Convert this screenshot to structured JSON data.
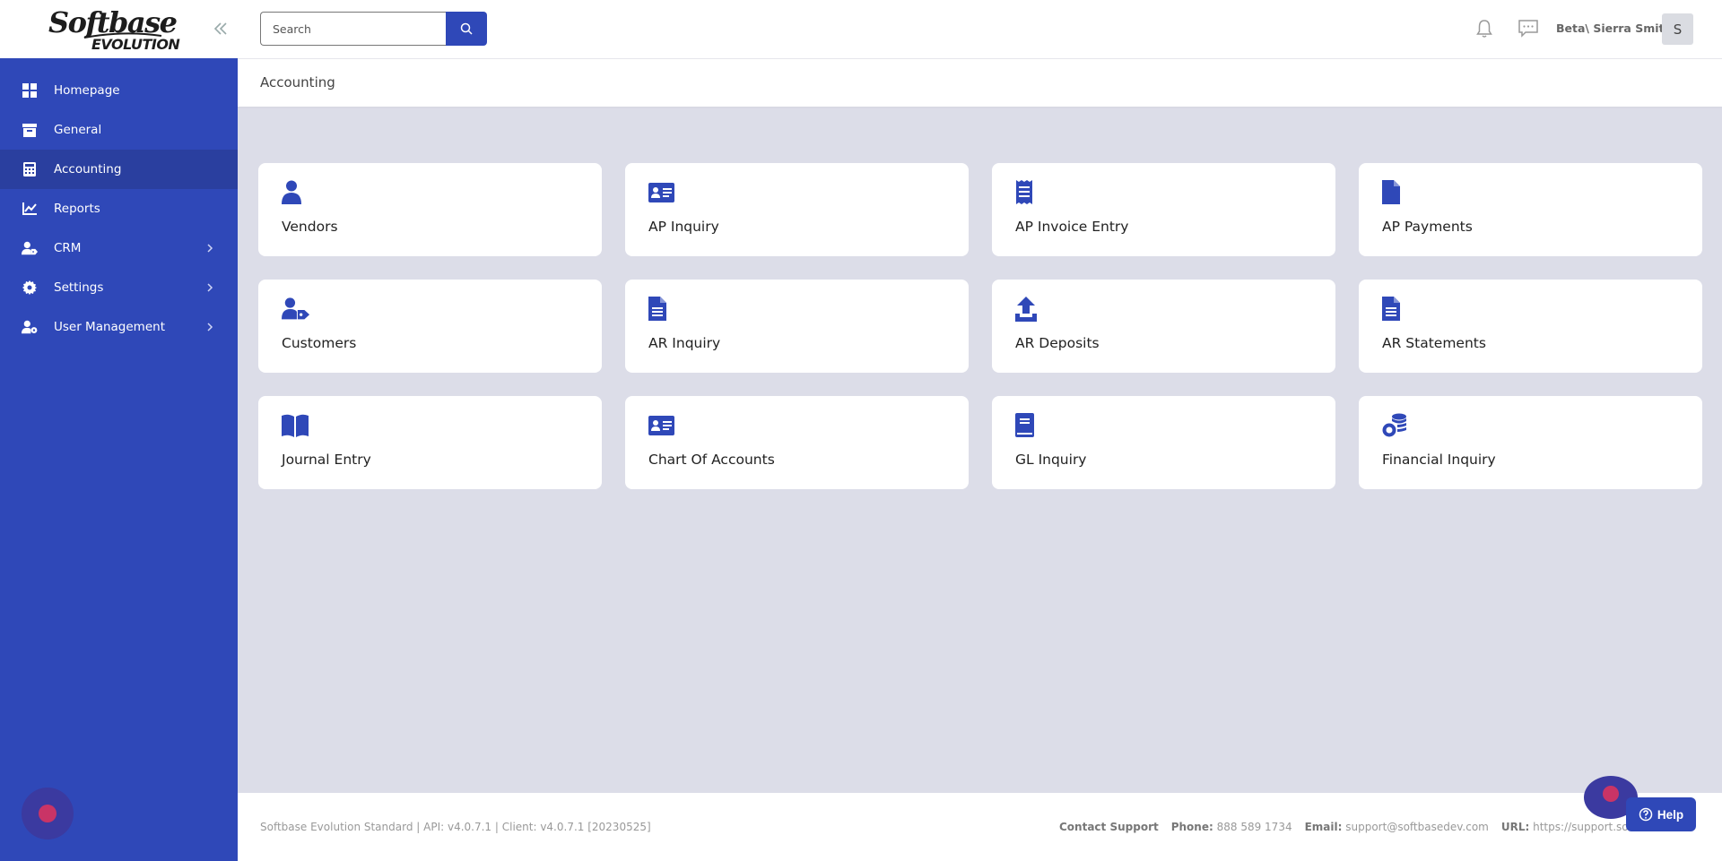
{
  "brand": {
    "line1": "Softbase",
    "line2": "EVOLUTION"
  },
  "colors": {
    "primary": "#2f48b8",
    "primary_dark": "#2a3f9f",
    "background": "#dcdde8",
    "accent": "#c93466"
  },
  "sidebar": {
    "items": [
      {
        "label": "Homepage",
        "icon": "grid-icon"
      },
      {
        "label": "General",
        "icon": "archive-icon"
      },
      {
        "label": "Accounting",
        "icon": "calculator-icon",
        "active": true
      },
      {
        "label": "Reports",
        "icon": "chart-line-icon"
      },
      {
        "label": "CRM",
        "icon": "user-tag-icon",
        "expandable": true
      },
      {
        "label": "Settings",
        "icon": "gear-icon",
        "expandable": true
      },
      {
        "label": "User Management",
        "icon": "user-gear-icon",
        "expandable": true
      }
    ]
  },
  "header": {
    "search_placeholder": "Search",
    "user_name": "Beta\\ Sierra Smith",
    "avatar_initial": "S"
  },
  "breadcrumb": "Accounting",
  "tiles": [
    {
      "label": "Vendors",
      "icon": "user-icon"
    },
    {
      "label": "AP Inquiry",
      "icon": "id-card-icon"
    },
    {
      "label": "AP Invoice Entry",
      "icon": "receipt-icon"
    },
    {
      "label": "AP Payments",
      "icon": "file-icon"
    },
    {
      "label": "Customers",
      "icon": "user-tag-icon"
    },
    {
      "label": "AR Inquiry",
      "icon": "file-lines-icon"
    },
    {
      "label": "AR Deposits",
      "icon": "upload-icon"
    },
    {
      "label": "AR Statements",
      "icon": "file-lines-icon"
    },
    {
      "label": "Journal Entry",
      "icon": "book-open-icon"
    },
    {
      "label": "Chart Of Accounts",
      "icon": "id-card-icon"
    },
    {
      "label": "GL Inquiry",
      "icon": "book-icon"
    },
    {
      "label": "Financial Inquiry",
      "icon": "coins-icon"
    }
  ],
  "footer": {
    "version": "Softbase Evolution Standard | API: v4.0.7.1 | Client: v4.0.7.1 [20230525]",
    "contact_label": "Contact Support",
    "phone_label": "Phone:",
    "phone": "888 589 1734",
    "email_label": "Email:",
    "email": "support@softbasedev.com",
    "url_label": "URL:",
    "url": "https://support.softbase",
    "help_label": "Help"
  }
}
